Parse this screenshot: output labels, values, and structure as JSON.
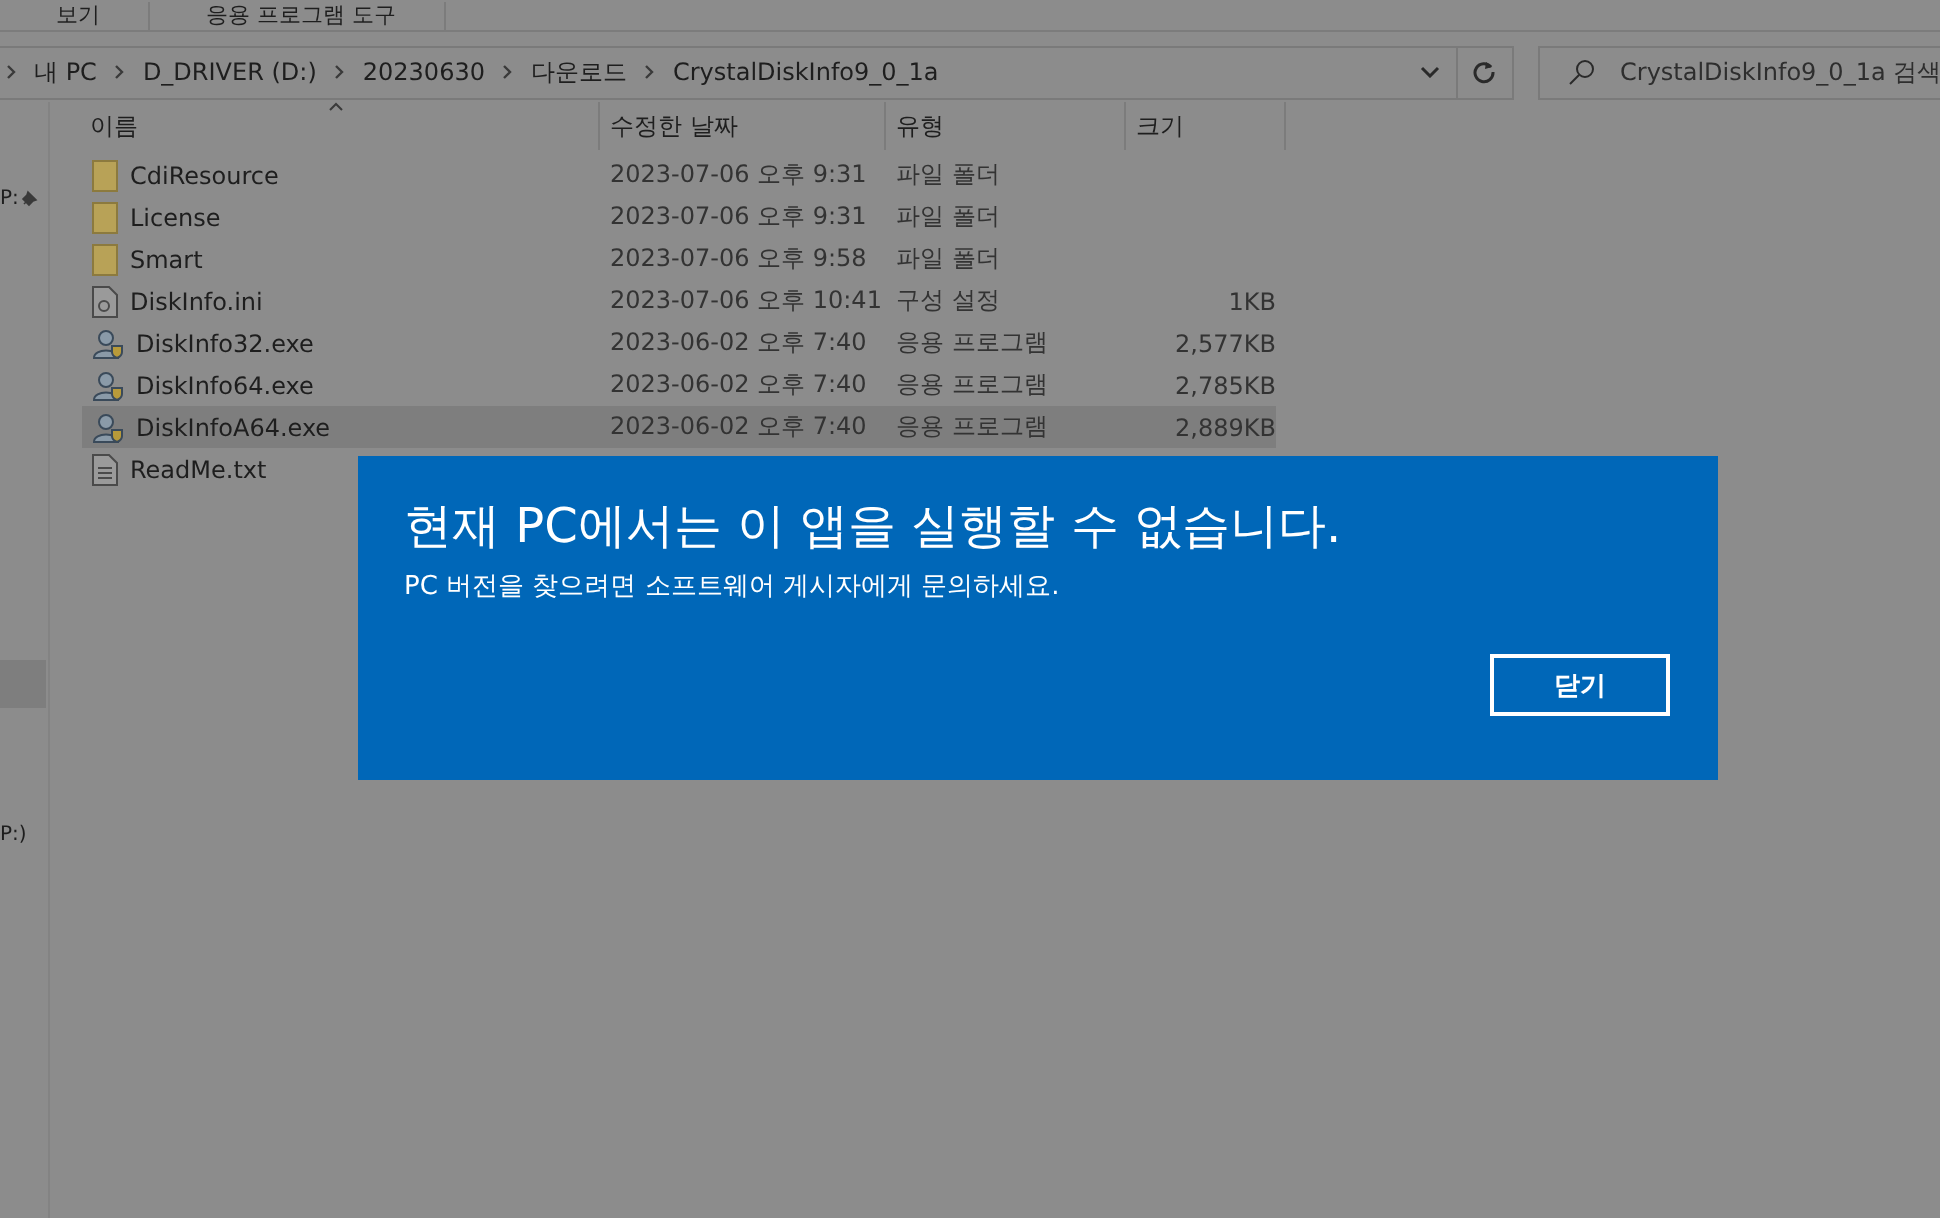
{
  "ribbon": {
    "tabs": [
      {
        "label": "보기",
        "selected": false
      },
      {
        "label": "응용 프로그램 도구",
        "selected": false
      }
    ]
  },
  "address_bar": {
    "crumbs": [
      "내 PC",
      "D_DRIVER (D:)",
      "20230630",
      "다운로드",
      "CrystalDiskInfo9_0_1a"
    ]
  },
  "search": {
    "placeholder": "CrystalDiskInfo9_0_1a 검색"
  },
  "sidebar": {
    "items": [
      {
        "label": "P:",
        "pinned": true
      },
      {
        "label": "P:)",
        "pinned": false
      }
    ]
  },
  "table": {
    "columns": [
      "이름",
      "수정한 날짜",
      "유형",
      "크기"
    ],
    "rows": [
      {
        "kind": "folder",
        "name": "CdiResource",
        "date": "2023-07-06 오후 9:31",
        "type": "파일 폴더",
        "size": null,
        "selected": false
      },
      {
        "kind": "folder",
        "name": "License",
        "date": "2023-07-06 오후 9:31",
        "type": "파일 폴더",
        "size": null,
        "selected": false
      },
      {
        "kind": "folder",
        "name": "Smart",
        "date": "2023-07-06 오후 9:58",
        "type": "파일 폴더",
        "size": null,
        "selected": false
      },
      {
        "kind": "settings",
        "name": "DiskInfo.ini",
        "date": "2023-07-06 오후 10:41",
        "type": "구성 설정",
        "size": "1KB",
        "selected": false
      },
      {
        "kind": "app",
        "name": "DiskInfo32.exe",
        "date": "2023-06-02 오후 7:40",
        "type": "응용 프로그램",
        "size": "2,577KB",
        "selected": false
      },
      {
        "kind": "app",
        "name": "DiskInfo64.exe",
        "date": "2023-06-02 오후 7:40",
        "type": "응용 프로그램",
        "size": "2,785KB",
        "selected": false
      },
      {
        "kind": "app",
        "name": "DiskInfoA64.exe",
        "date": "2023-06-02 오후 7:40",
        "type": "응용 프로그램",
        "size": "2,889KB",
        "selected": true
      },
      {
        "kind": "text",
        "name": "ReadMe.txt",
        "date": null,
        "type": null,
        "size": null,
        "selected": false
      }
    ]
  },
  "dialog": {
    "title": "현재 PC에서는 이 앱을 실행할 수 없습니다.",
    "message": "PC 버전을 찾으려면 소프트웨어 게시자에게 문의하세요.",
    "button": "닫기"
  }
}
